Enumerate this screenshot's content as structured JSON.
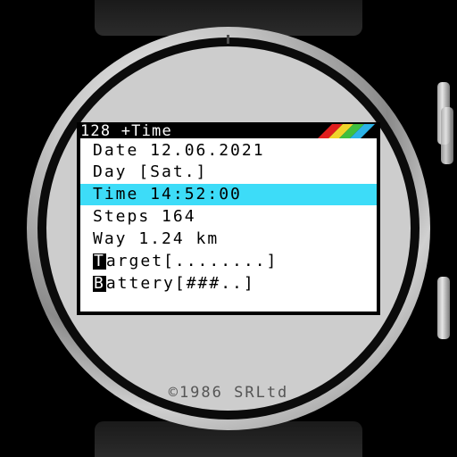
{
  "menu": {
    "title": "128 +Time",
    "stripe_colors": [
      "#e01e1e",
      "#f0d42a",
      "#3fbf3f",
      "#2bb3e8"
    ],
    "items": [
      {
        "label": "Date 12.06.2021",
        "selected": false
      },
      {
        "label": "Day [Sat.]",
        "selected": false
      },
      {
        "label": "Time 14:52:00",
        "selected": true
      },
      {
        "label": "Steps 164",
        "selected": false
      },
      {
        "label": "Way 1.24 km",
        "selected": false
      },
      {
        "hotkey": "T",
        "rest": "arget[........]",
        "selected": false
      },
      {
        "hotkey": "B",
        "rest": "attery[###..]",
        "selected": false
      }
    ],
    "selected_color": "#3ddcf8"
  },
  "footer": {
    "copyright": "©1986 SRLtd"
  }
}
